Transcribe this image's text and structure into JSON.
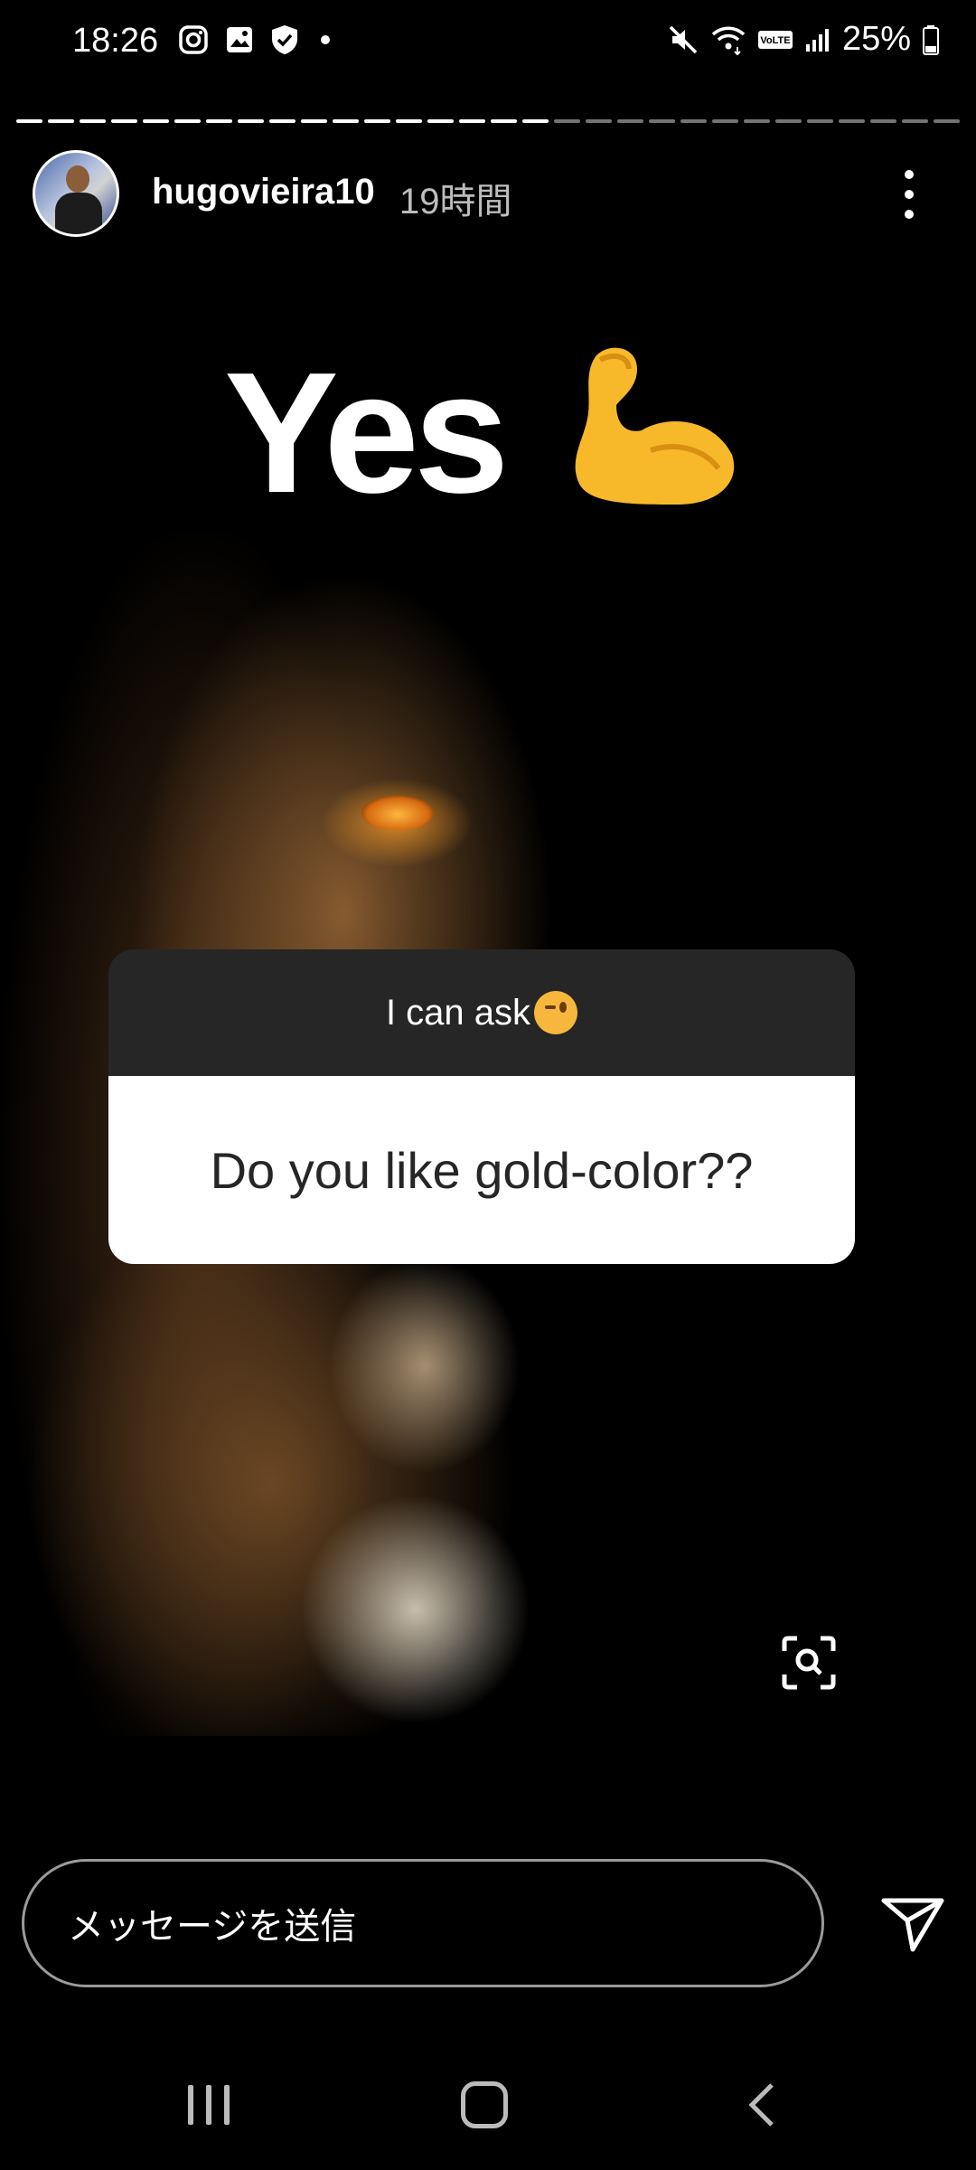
{
  "status_bar": {
    "time": "18:26",
    "battery": "25%",
    "left_icons": [
      "instagram-icon",
      "gallery-icon",
      "shield-check-icon",
      "dot-icon"
    ],
    "right_icons": [
      "mute-icon",
      "wifi-icon",
      "volte-icon",
      "signal-icon",
      "battery-icon"
    ]
  },
  "story": {
    "progress": {
      "segments": 30,
      "completed": 17
    },
    "username": "hugovieira10",
    "time_ago": "19時間",
    "headline": "Yes",
    "headline_emoji": "flexed-biceps-icon"
  },
  "question_card": {
    "header": "I can ask",
    "header_emoji": "winking-face-icon",
    "question": "Do you like gold-color??"
  },
  "reply": {
    "placeholder": "メッセージを送信",
    "send_icon": "send-icon"
  },
  "colors": {
    "background": "#000000",
    "card_header": "#262626",
    "card_body": "#ffffff",
    "input_border": "#9a9a9a"
  }
}
